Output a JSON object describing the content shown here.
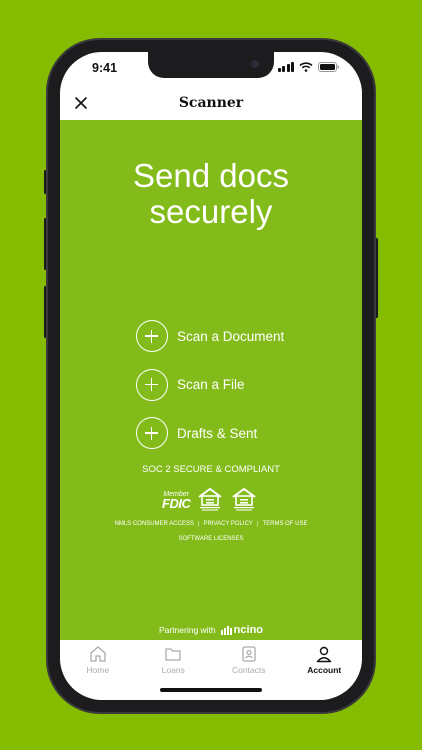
{
  "status": {
    "time": "9:41"
  },
  "header": {
    "title": "Scanner"
  },
  "hero": {
    "line1": "Send docs",
    "line2": "securely"
  },
  "actions": [
    {
      "label": "Scan a Document"
    },
    {
      "label": "Scan a File"
    },
    {
      "label": "Drafts & Sent"
    }
  ],
  "compliance": {
    "soc": "SOC 2 SECURE & COMPLIANT",
    "fdic_member": "Member",
    "fdic": "FDIC"
  },
  "links": {
    "nmls": "NMLS CONSUMER ACCESS",
    "privacy": "PRIVACY POLICY",
    "terms": "TERMS OF USE",
    "software": "SOFTWARE LICENSES",
    "separator": "|"
  },
  "partner": {
    "prefix": "Partnering with",
    "brand": "ncino"
  },
  "tabs": [
    {
      "label": "Home",
      "icon": "home-icon"
    },
    {
      "label": "Loans",
      "icon": "folder-icon"
    },
    {
      "label": "Contacts",
      "icon": "contacts-icon"
    },
    {
      "label": "Account",
      "icon": "person-icon",
      "active": true
    }
  ],
  "colors": {
    "brand_green": "#83bc1a",
    "background_green": "#86bc00"
  }
}
